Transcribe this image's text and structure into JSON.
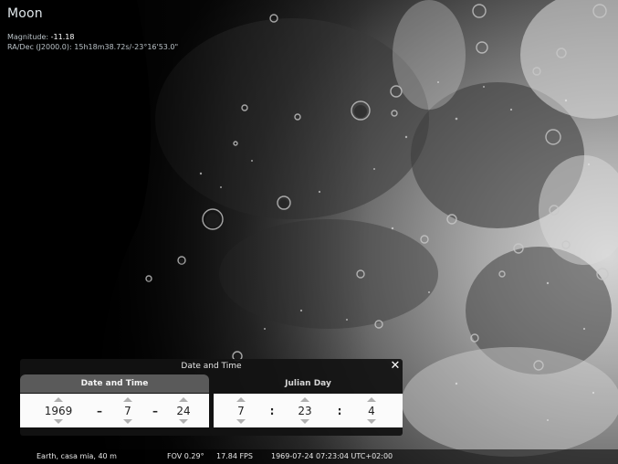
{
  "object": {
    "name": "Moon",
    "magnitude_label": "Magnitude:",
    "magnitude_value": "-11.18",
    "radec_label": "RA/Dec (J2000.0):",
    "radec_value": "15h18m38.72s/-23°16'53.0\""
  },
  "dialog": {
    "title": "Date and Time",
    "close_glyph": "✕",
    "tabs": [
      "Date and Time",
      "Julian Day"
    ],
    "active_tab": "Date and Time",
    "date": {
      "year": "1969",
      "month": "7",
      "day": "24",
      "separator": "–"
    },
    "time": {
      "hour": "7",
      "minute": "23",
      "second": "4",
      "separator": ":"
    }
  },
  "status": {
    "location": "Earth, casa mia, 40 m",
    "fov": "FOV 0.29°",
    "fps": "17.84 FPS",
    "datetime": "1969-07-24 07:23:04 UTC+02:00"
  },
  "icons": {
    "spin_up": "triangle-up-icon",
    "spin_down": "triangle-down-icon",
    "close": "close-icon"
  },
  "colors": {
    "dialog_bg": "#121212",
    "active_tab": "#5a5a5a",
    "panel_bg": "#fbfbfb"
  }
}
